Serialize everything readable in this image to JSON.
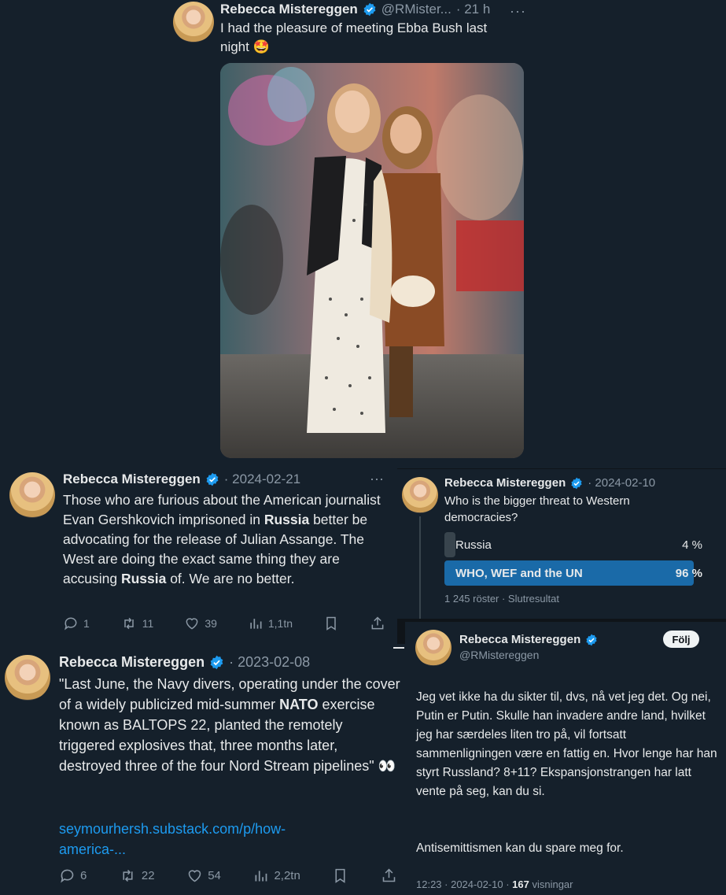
{
  "accent": "#1d9bf0",
  "verified_color": "#1d9bf0",
  "tweet1": {
    "name": "Rebecca Mistereggen",
    "handle": "@RMister...",
    "time": "· 21 h",
    "text": "I had the pleasure of meeting Ebba Bush last night 🤩",
    "more_icon": "more-icon"
  },
  "tweet2": {
    "name": "Rebecca Mistereggen",
    "date": "· 2024-02-21",
    "text_html_parts": [
      {
        "t": "Those who are furious about the American journalist Evan Gershkovich imprisoned in ",
        "b": false
      },
      {
        "t": "Russia",
        "b": true
      },
      {
        "t": " better be advocating for the release of Julian Assange. The West are doing the exact same thing they are accusing ",
        "b": false
      },
      {
        "t": "Russia",
        "b": true
      },
      {
        "t": " of. We are no better.",
        "b": false
      }
    ],
    "replies": "1",
    "retweets": "11",
    "likes": "39",
    "views": "1,1tn"
  },
  "tweet3": {
    "name": "Rebecca Mistereggen",
    "date": "· 2024-02-10",
    "question": "Who is the bigger threat to Western democracies?",
    "poll": [
      {
        "label": "Russia",
        "pct": "4 %",
        "fraction": 0.04,
        "winner": false
      },
      {
        "label": "WHO, WEF and the UN",
        "pct": "96 %",
        "fraction": 0.96,
        "winner": true
      }
    ],
    "footer": "1 245 röster · Slutresultat"
  },
  "tweet4": {
    "name": "Rebecca Mistereggen",
    "date": "· 2023-02-08",
    "text_parts": [
      {
        "t": "\"Last June, the Navy divers, operating under the cover of a widely publicized mid-summer ",
        "b": false
      },
      {
        "t": "NATO",
        "b": true
      },
      {
        "t": " exercise known as BALTOPS 22, planted the remotely triggered explosives that, three months later, destroyed three of the four Nord Stream pipelines\" 👀",
        "b": false
      }
    ],
    "link_line1": "seymourhersh.substack.com/p/how-",
    "link_line2": "america-...",
    "replies": "6",
    "retweets": "22",
    "likes": "54",
    "views": "2,2tn"
  },
  "tweet5": {
    "name": "Rebecca Mistereggen",
    "handle": "@RMistereggen",
    "follow": "Följ",
    "para1": "Jeg vet ikke ha du sikter til, dvs, nå vet jeg det. Og nei, Putin er Putin. Skulle han invadere andre land, hvilket jeg har særdeles liten tro på, vil fortsatt sammenligningen være en fattig en. Hvor lenge har han styrt Russland? 8+11? Ekspansjonstrangen har latt vente på seg, kan du si.",
    "para2": "Antisemittismen kan du spare meg for.",
    "meta_time": "12:23 · 2024-02-10 · ",
    "meta_views": "167",
    "meta_views_label": " visningar"
  }
}
